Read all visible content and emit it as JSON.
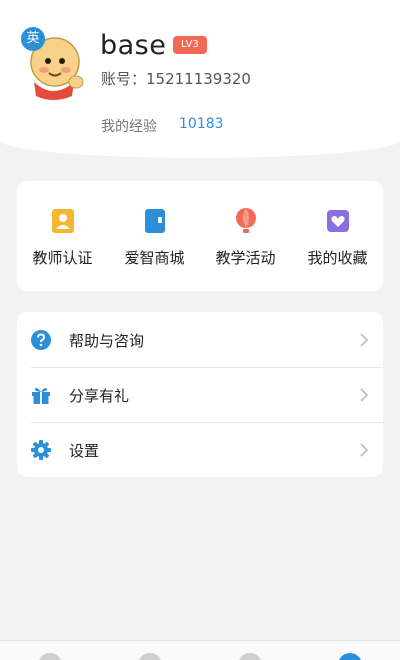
{
  "profile": {
    "avatar_badge": "英",
    "username": "base",
    "level": "LV3",
    "account": "账号：15211139320",
    "experience_label": "我的经验",
    "experience_value": "10183"
  },
  "features": [
    {
      "label": "教师认证",
      "icon": "id-card-icon",
      "color": "#f5b731"
    },
    {
      "label": "爱智商城",
      "icon": "shop-icon",
      "color": "#2d8fd8"
    },
    {
      "label": "教学活动",
      "icon": "hot-air-balloon-icon",
      "color": "#f26a55"
    },
    {
      "label": "我的收藏",
      "icon": "heart-icon",
      "color": "#8b6fe0"
    }
  ],
  "menu": [
    {
      "label": "帮助与咨询",
      "icon": "help-icon"
    },
    {
      "label": "分享有礼",
      "icon": "gift-icon"
    },
    {
      "label": "设置",
      "icon": "settings-gear-icon"
    }
  ],
  "colors": {
    "accent": "#2d8fd8",
    "level_badge": "#f26a55",
    "background": "#f2f2f2"
  }
}
